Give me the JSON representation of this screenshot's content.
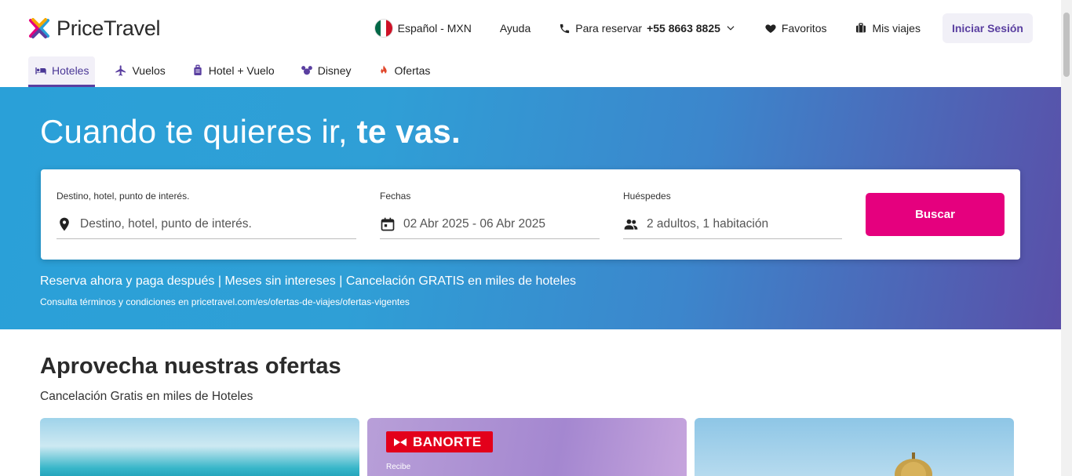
{
  "brand": {
    "name": "PriceTravel"
  },
  "top_nav": {
    "language_currency": "Español - MXN",
    "help": "Ayuda",
    "reserve_label": "Para reservar",
    "reserve_phone": "+55 8663 8825",
    "favorites": "Favoritos",
    "my_trips": "Mis viajes",
    "login": "Iniciar Sesión"
  },
  "tabs": [
    {
      "label": "Hoteles",
      "icon": "bed-icon",
      "active": true
    },
    {
      "label": "Vuelos",
      "icon": "plane-icon",
      "active": false
    },
    {
      "label": "Hotel + Vuelo",
      "icon": "luggage-icon",
      "active": false
    },
    {
      "label": "Disney",
      "icon": "mickey-icon",
      "active": false
    },
    {
      "label": "Ofertas",
      "icon": "fire-icon",
      "active": false
    }
  ],
  "hero": {
    "title_light": "Cuando te quieres ir, ",
    "title_bold": "te vas.",
    "promo": "Reserva ahora y paga después | Meses sin intereses | Cancelación GRATIS en miles de hoteles",
    "terms": "Consulta términos y condiciones en pricetravel.com/es/ofertas-de-viajes/ofertas-vigentes"
  },
  "search": {
    "destination_label": "Destino, hotel, punto de interés.",
    "destination_placeholder": "Destino, hotel, punto de interés.",
    "dates_label": "Fechas",
    "dates_value": "02 Abr 2025 - 06 Abr 2025",
    "guests_label": "Huéspedes",
    "guests_value": "2 adultos, 1 habitación",
    "button": "Buscar"
  },
  "offers": {
    "title": "Aprovecha nuestras ofertas",
    "subtitle": "Cancelación Gratis en miles de Hoteles",
    "banorte_brand": "BANORTE",
    "banorte_small": "Recibe"
  },
  "colors": {
    "accent_purple": "#5a3fa0",
    "search_button": "#e5007e",
    "hero_start": "#2aa0d8",
    "hero_end": "#5a4fa8"
  }
}
